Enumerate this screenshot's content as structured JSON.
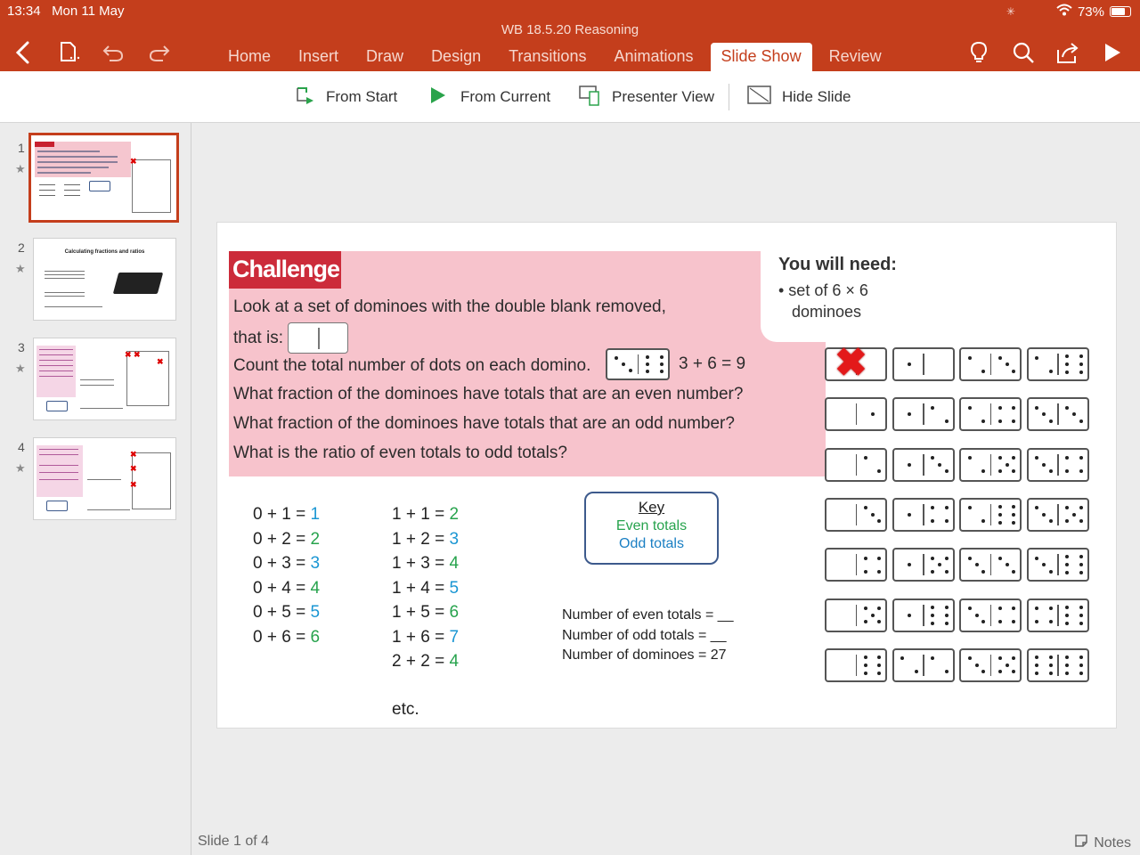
{
  "status": {
    "time": "13:34",
    "date": "Mon 11 May",
    "battery": "73%"
  },
  "document": {
    "title": "WB 18.5.20 Reasoning"
  },
  "ribbon": {
    "tabs": [
      "Home",
      "Insert",
      "Draw",
      "Design",
      "Transitions",
      "Animations",
      "Slide Show",
      "Review"
    ],
    "active_tab": "Slide Show"
  },
  "toolbar": {
    "from_start": "From Start",
    "from_current": "From Current",
    "presenter_view": "Presenter View",
    "hide_slide": "Hide Slide"
  },
  "thumbnails": [
    {
      "number": "1"
    },
    {
      "number": "2",
      "title": "Calculating fractions and ratios"
    },
    {
      "number": "3"
    },
    {
      "number": "4"
    }
  ],
  "footer": {
    "slide_counter": "Slide 1 of 4",
    "notes": "Notes"
  },
  "slide": {
    "banner": "Challenge",
    "lines": [
      "Look at a set of dominoes with the double blank removed,",
      "that is:",
      "Count the total number of dots on each domino.",
      "What fraction of the dominoes have totals that are an even number?",
      "What fraction of the dominoes have totals that are an odd number?",
      "What is the ratio of even totals to odd totals?"
    ],
    "example_sum": "3 + 6 = 9",
    "need": {
      "title": "You will need:",
      "item1": "• set of 6 × 6",
      "item2": "dominoes"
    },
    "equations_col1": [
      {
        "expr": "0 + 1 = ",
        "result": "1",
        "even": false
      },
      {
        "expr": "0 + 2 = ",
        "result": "2",
        "even": true
      },
      {
        "expr": "0 + 3 = ",
        "result": "3",
        "even": false
      },
      {
        "expr": "0 + 4 = ",
        "result": "4",
        "even": true
      },
      {
        "expr": "0 + 5 = ",
        "result": "5",
        "even": false
      },
      {
        "expr": "0 + 6 = ",
        "result": "6",
        "even": true
      }
    ],
    "equations_col2": [
      {
        "expr": "1 + 1 = ",
        "result": "2",
        "even": true
      },
      {
        "expr": "1 + 2 = ",
        "result": "3",
        "even": false
      },
      {
        "expr": "1 + 3 = ",
        "result": "4",
        "even": true
      },
      {
        "expr": "1 + 4 = ",
        "result": "5",
        "even": false
      },
      {
        "expr": "1 + 5 = ",
        "result": "6",
        "even": true
      },
      {
        "expr": "1 + 6 = ",
        "result": "7",
        "even": false
      },
      {
        "expr": "2 + 2 = ",
        "result": "4",
        "even": true
      }
    ],
    "etc": "etc.",
    "key": {
      "title": "Key",
      "even": "Even totals",
      "odd": "Odd totals"
    },
    "counts": {
      "even": "Number of even totals = __",
      "odd": "Number of odd totals = __",
      "total": "Number of dominoes = 27"
    },
    "dominoes": [
      [
        [
          0,
          0
        ],
        [
          1,
          0
        ],
        [
          2,
          3
        ],
        [
          2,
          6
        ]
      ],
      [
        [
          0,
          1
        ],
        [
          1,
          2
        ],
        [
          2,
          4
        ],
        [
          3,
          3
        ]
      ],
      [
        [
          0,
          2
        ],
        [
          1,
          3
        ],
        [
          2,
          5
        ],
        [
          3,
          4
        ]
      ],
      [
        [
          0,
          3
        ],
        [
          1,
          4
        ],
        [
          2,
          6
        ],
        [
          3,
          5
        ]
      ],
      [
        [
          0,
          4
        ],
        [
          1,
          5
        ],
        [
          3,
          3
        ],
        [
          3,
          6
        ]
      ],
      [
        [
          0,
          5
        ],
        [
          1,
          6
        ],
        [
          3,
          4
        ],
        [
          4,
          6
        ]
      ],
      [
        [
          0,
          6
        ],
        [
          2,
          2
        ],
        [
          3,
          5
        ],
        [
          6,
          6
        ]
      ]
    ],
    "crossed": [
      [
        0,
        0
      ]
    ]
  },
  "colors": {
    "accent": "#c43e1c",
    "even": "#27a34d",
    "odd": "#1a96d3",
    "challenge_pink": "#f7c3cc",
    "banner_red": "#cc2b3a"
  }
}
